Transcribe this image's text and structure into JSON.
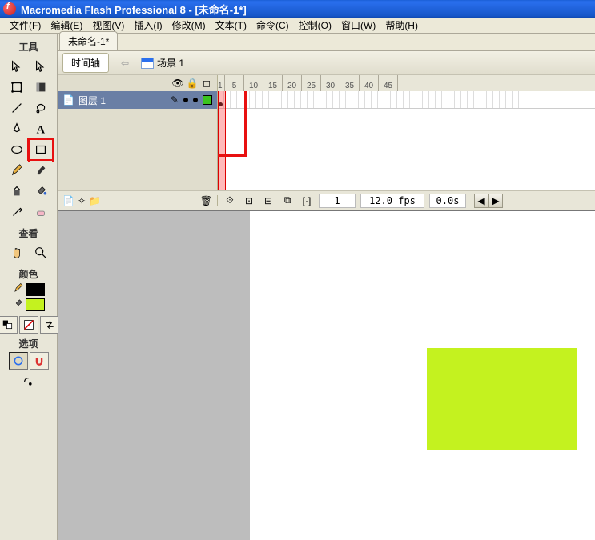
{
  "app": {
    "title": "Macromedia Flash Professional 8 - [未命名-1*]"
  },
  "menu": {
    "file": "文件(F)",
    "edit": "编辑(E)",
    "view": "视图(V)",
    "insert": "插入(I)",
    "modify": "修改(M)",
    "text": "文本(T)",
    "command": "命令(C)",
    "control": "控制(O)",
    "window": "窗口(W)",
    "help": "帮助(H)"
  },
  "tools_panel": {
    "title": "工具",
    "view_label": "查看",
    "colors_label": "颜色",
    "options_label": "选项"
  },
  "document": {
    "tab_title": "未命名-1*",
    "timeline_tab": "时间轴",
    "scene_label": "场景 1"
  },
  "timeline": {
    "ticks": [
      "1",
      "5",
      "10",
      "15",
      "20",
      "25",
      "30",
      "35",
      "40",
      "45"
    ],
    "layer_name": "图层 1",
    "footer": {
      "current_frame": "1",
      "fps": "12.0 fps",
      "elapsed": "0.0s"
    }
  },
  "colors": {
    "stroke": "#000000",
    "fill": "#c4f21f"
  },
  "stage": {
    "shape_color": "#c4f21f"
  }
}
